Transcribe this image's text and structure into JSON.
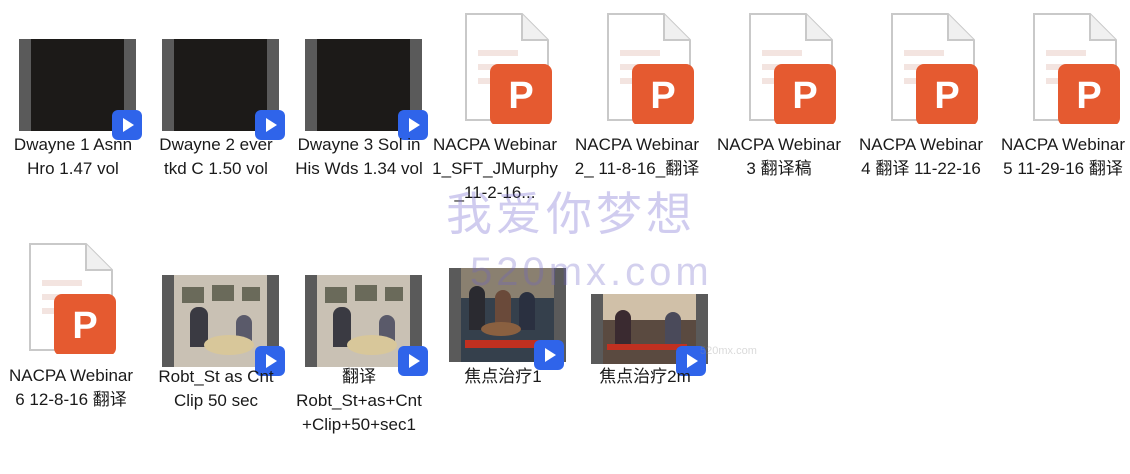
{
  "colors": {
    "accent_play": "#2f64ea",
    "ppt_orange": "#e55a30",
    "ppt_red": "#c43a1c"
  },
  "files": [
    {
      "type": "video",
      "style": "dark",
      "label": "Dwayne 1 Asnn Hro 1.47 vol"
    },
    {
      "type": "video",
      "style": "dark",
      "label": "Dwayne 2 ever tkd C 1.50 vol"
    },
    {
      "type": "video",
      "style": "dark",
      "label": "Dwayne 3 Sol in His Wds 1.34 vol"
    },
    {
      "type": "ppt",
      "label": "NACPA Webinar 1_SFT_JMurphy_11-2-16..."
    },
    {
      "type": "ppt",
      "label": "NACPA Webinar 2_ 11-8-16_翻译"
    },
    {
      "type": "ppt",
      "label": "NACPA Webinar 3 翻译稿"
    },
    {
      "type": "ppt",
      "label": "NACPA Webinar 4 翻译 11-22-16"
    },
    {
      "type": "ppt",
      "label": "NACPA Webinar 5 11-29-16 翻译"
    },
    {
      "type": "ppt",
      "label": "NACPA Webinar 6 12-8-16 翻译"
    },
    {
      "type": "video",
      "style": "room",
      "label": "Robt_St as Cnt Clip 50 sec"
    },
    {
      "type": "video",
      "style": "room",
      "label": "翻译Robt_St+as+Cnt+Clip+50+sec1"
    },
    {
      "type": "video",
      "style": "group",
      "label": "焦点治疗1"
    },
    {
      "type": "video",
      "style": "clinic",
      "label": "焦点治疗2m"
    }
  ],
  "watermarks": {
    "main": "我爱你梦想",
    "domain": "520mx.com",
    "small": "520mx.com"
  }
}
